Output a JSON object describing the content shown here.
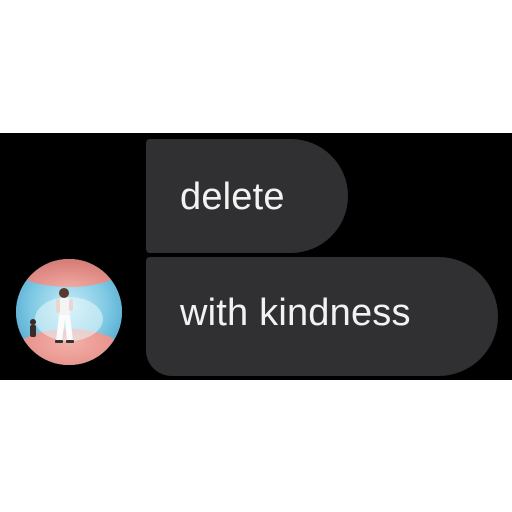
{
  "messages": [
    {
      "text": "delete"
    },
    {
      "text": "with kindness"
    }
  ],
  "avatar": {
    "icon": "profile-photo-avatar"
  },
  "colors": {
    "background": "#000000",
    "bubble": "#303033",
    "bubble_text": "#f2f2f2"
  }
}
